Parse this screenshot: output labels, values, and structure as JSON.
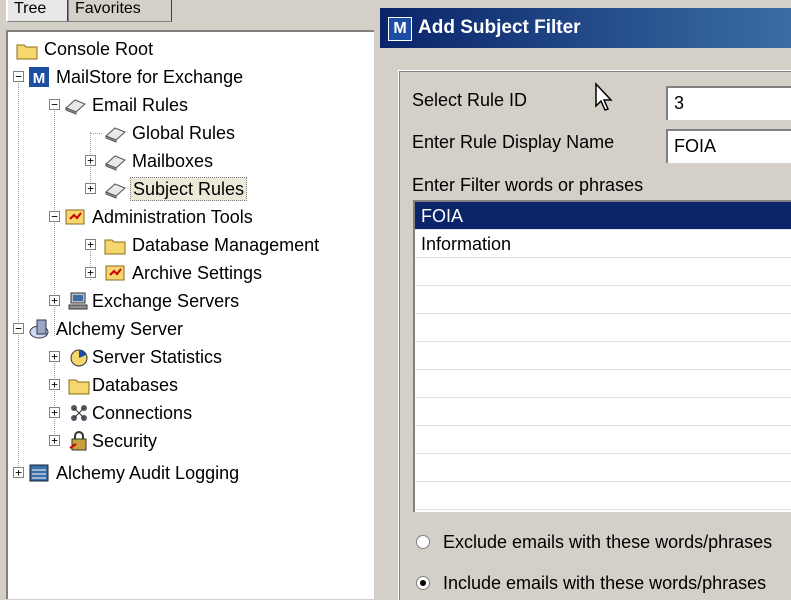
{
  "tabs": [
    "Tree",
    "Favorites"
  ],
  "tree": {
    "items": [
      {
        "label": "Console Root",
        "icon": "folder-icon"
      },
      {
        "label": "MailStore for Exchange",
        "icon": "mailstore-m-icon"
      },
      {
        "label": "Email Rules",
        "icon": "rules-book-icon"
      },
      {
        "label": "Global Rules",
        "icon": "rules-book-icon"
      },
      {
        "label": "Mailboxes",
        "icon": "rules-book-icon"
      },
      {
        "label": "Subject Rules",
        "icon": "rules-book-icon"
      },
      {
        "label": "Administration Tools",
        "icon": "admin-tools-icon"
      },
      {
        "label": "Database Management",
        "icon": "folder-icon"
      },
      {
        "label": "Archive Settings",
        "icon": "admin-tools-icon"
      },
      {
        "label": "Exchange Servers",
        "icon": "server-computer-icon"
      },
      {
        "label": "Alchemy Server",
        "icon": "alchemy-server-icon"
      },
      {
        "label": "Server Statistics",
        "icon": "statistics-icon"
      },
      {
        "label": "Databases",
        "icon": "folder-icon"
      },
      {
        "label": "Connections",
        "icon": "connections-icon"
      },
      {
        "label": "Security",
        "icon": "security-icon"
      },
      {
        "label": "Alchemy Audit Logging",
        "icon": "audit-log-icon"
      }
    ]
  },
  "dialog": {
    "title": "Add Subject Filter",
    "title_icon": "M",
    "rule_id_label": "Select Rule ID",
    "rule_id_value": "3",
    "display_name_label": "Enter Rule Display Name",
    "display_name_value": "FOIA",
    "filter_label": "Enter Filter words or phrases",
    "filter_items": [
      "FOIA",
      "Information"
    ],
    "exclude_label": "Exclude emails with these words/phrases",
    "include_label": "Include emails with these words/phrases",
    "selected_option": "include"
  },
  "colors": {
    "title_bar": "#0a246a",
    "selection": "#0a246a",
    "dialog_bg": "#d4d0c8"
  }
}
